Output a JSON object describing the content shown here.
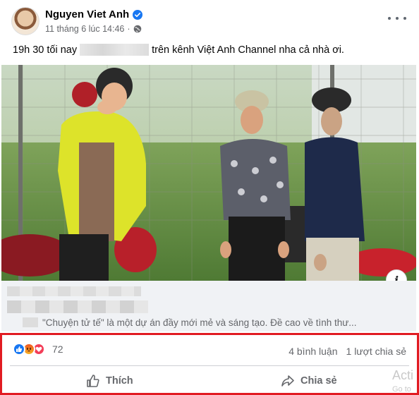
{
  "post": {
    "author": "Nguyen Viet Anh",
    "timestamp": "11 tháng 6 lúc 14:46",
    "privacy_icon": "globe-icon",
    "caption_before": "19h 30 tối nay",
    "caption_after": "trên kênh Việt Anh Channel nha cả nhà ơi."
  },
  "link_preview": {
    "description": "\"Chuyện tử tế\" là một dự án đầy mới mẻ và sáng tạo. Đề cao về tình thư..."
  },
  "engagement": {
    "reactions": [
      "like-icon",
      "angry-icon",
      "love-icon"
    ],
    "reaction_count": "72",
    "comments": "4 bình luận",
    "shares": "1 lượt chia sẻ"
  },
  "actions": {
    "like_label": "Thích",
    "share_label": "Chia sẻ"
  },
  "watermark": {
    "line1": "Acti",
    "line2": "Go to"
  },
  "colors": {
    "highlight": "#e11b22",
    "facebook_blue": "#1877f2",
    "secondary_text": "#65676b"
  }
}
